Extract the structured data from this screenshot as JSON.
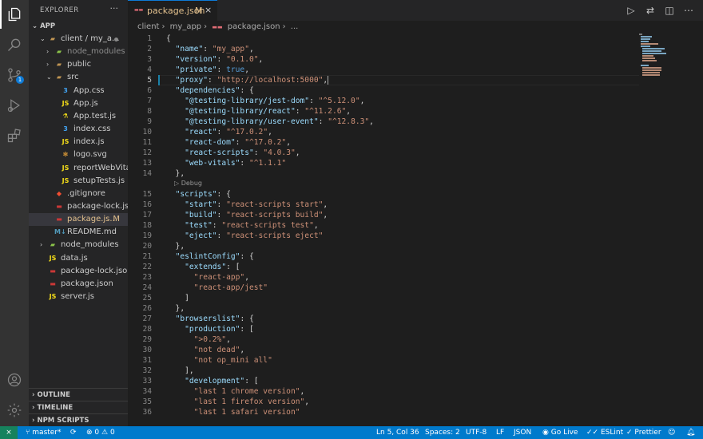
{
  "sidebar": {
    "title": "EXPLORER",
    "more": "···",
    "section": "APP",
    "tree": [
      {
        "name": "client / my_a...",
        "depth": 1,
        "type": "folder",
        "open": true,
        "icon": "folder-icon",
        "dot": true
      },
      {
        "name": "node_modules",
        "depth": 2,
        "type": "folder",
        "open": false,
        "icon": "node-folder-icon",
        "dim": true
      },
      {
        "name": "public",
        "depth": 2,
        "type": "folder",
        "open": false,
        "icon": "folder-icon"
      },
      {
        "name": "src",
        "depth": 2,
        "type": "folder",
        "open": true,
        "icon": "folder-icon"
      },
      {
        "name": "App.css",
        "depth": 3,
        "type": "file",
        "icon": "css-icon"
      },
      {
        "name": "App.js",
        "depth": 3,
        "type": "file",
        "icon": "js-icon"
      },
      {
        "name": "App.test.js",
        "depth": 3,
        "type": "file",
        "icon": "test-icon"
      },
      {
        "name": "index.css",
        "depth": 3,
        "type": "file",
        "icon": "css-icon"
      },
      {
        "name": "index.js",
        "depth": 3,
        "type": "file",
        "icon": "js-icon"
      },
      {
        "name": "logo.svg",
        "depth": 3,
        "type": "file",
        "icon": "svg-icon"
      },
      {
        "name": "reportWebVita...",
        "depth": 3,
        "type": "file",
        "icon": "js-icon"
      },
      {
        "name": "setupTests.js",
        "depth": 3,
        "type": "file",
        "icon": "js-icon"
      },
      {
        "name": ".gitignore",
        "depth": 2,
        "type": "file",
        "icon": "git-icon"
      },
      {
        "name": "package-lock.js...",
        "depth": 2,
        "type": "file",
        "icon": "npm-icon"
      },
      {
        "name": "package.js...",
        "depth": 2,
        "type": "file",
        "icon": "npm-icon",
        "selected": true,
        "mod": "M"
      },
      {
        "name": "README.md",
        "depth": 2,
        "type": "file",
        "icon": "md-icon"
      },
      {
        "name": "node_modules",
        "depth": 1,
        "type": "folder",
        "open": false,
        "icon": "node-folder-icon"
      },
      {
        "name": "data.js",
        "depth": 1,
        "type": "file",
        "icon": "js-icon"
      },
      {
        "name": "package-lock.json",
        "depth": 1,
        "type": "file",
        "icon": "npm-icon"
      },
      {
        "name": "package.json",
        "depth": 1,
        "type": "file",
        "icon": "npm-icon"
      },
      {
        "name": "server.js",
        "depth": 1,
        "type": "file",
        "icon": "js-icon"
      }
    ],
    "bottom_sections": [
      "OUTLINE",
      "TIMELINE",
      "NPM SCRIPTS"
    ]
  },
  "tab": {
    "label": "package.json",
    "mod": "M",
    "close": "×"
  },
  "breadcrumb": [
    "client",
    "my_app",
    "package.json",
    "..."
  ],
  "codelens": "▷ Debug",
  "colors": {
    "accent": "#007acc",
    "remote": "#16825d",
    "modified": "#e2c08d",
    "key": "#9cdcfe",
    "string": "#ce9178",
    "keyword": "#569cd6"
  },
  "code_lines": [
    {
      "n": "1",
      "t": [
        [
          "p",
          "{"
        ]
      ]
    },
    {
      "n": "2",
      "t": [
        [
          "p",
          "  "
        ],
        [
          "k",
          "\"name\""
        ],
        [
          "p",
          ": "
        ],
        [
          "s",
          "\"my_app\""
        ],
        [
          "p",
          ","
        ]
      ]
    },
    {
      "n": "3",
      "t": [
        [
          "p",
          "  "
        ],
        [
          "k",
          "\"version\""
        ],
        [
          "p",
          ": "
        ],
        [
          "s",
          "\"0.1.0\""
        ],
        [
          "p",
          ","
        ]
      ]
    },
    {
      "n": "4",
      "t": [
        [
          "p",
          "  "
        ],
        [
          "k",
          "\"private\""
        ],
        [
          "p",
          ": "
        ],
        [
          "b",
          "true"
        ],
        [
          "p",
          ","
        ]
      ]
    },
    {
      "n": "5",
      "t": [
        [
          "p",
          "  "
        ],
        [
          "k",
          "\"proxy\""
        ],
        [
          "p",
          ": "
        ],
        [
          "s",
          "\"http://localhost:5000\""
        ],
        [
          "p",
          ","
        ]
      ],
      "current": true
    },
    {
      "n": "6",
      "t": [
        [
          "p",
          "  "
        ],
        [
          "k",
          "\"dependencies\""
        ],
        [
          "p",
          ": {"
        ]
      ]
    },
    {
      "n": "7",
      "t": [
        [
          "p",
          "    "
        ],
        [
          "k",
          "\"@testing-library/jest-dom\""
        ],
        [
          "p",
          ": "
        ],
        [
          "s",
          "\"^5.12.0\""
        ],
        [
          "p",
          ","
        ]
      ]
    },
    {
      "n": "8",
      "t": [
        [
          "p",
          "    "
        ],
        [
          "k",
          "\"@testing-library/react\""
        ],
        [
          "p",
          ": "
        ],
        [
          "s",
          "\"^11.2.6\""
        ],
        [
          "p",
          ","
        ]
      ]
    },
    {
      "n": "9",
      "t": [
        [
          "p",
          "    "
        ],
        [
          "k",
          "\"@testing-library/user-event\""
        ],
        [
          "p",
          ": "
        ],
        [
          "s",
          "\"^12.8.3\""
        ],
        [
          "p",
          ","
        ]
      ]
    },
    {
      "n": "10",
      "t": [
        [
          "p",
          "    "
        ],
        [
          "k",
          "\"react\""
        ],
        [
          "p",
          ": "
        ],
        [
          "s",
          "\"^17.0.2\""
        ],
        [
          "p",
          ","
        ]
      ]
    },
    {
      "n": "11",
      "t": [
        [
          "p",
          "    "
        ],
        [
          "k",
          "\"react-dom\""
        ],
        [
          "p",
          ": "
        ],
        [
          "s",
          "\"^17.0.2\""
        ],
        [
          "p",
          ","
        ]
      ]
    },
    {
      "n": "12",
      "t": [
        [
          "p",
          "    "
        ],
        [
          "k",
          "\"react-scripts\""
        ],
        [
          "p",
          ": "
        ],
        [
          "s",
          "\"4.0.3\""
        ],
        [
          "p",
          ","
        ]
      ]
    },
    {
      "n": "13",
      "t": [
        [
          "p",
          "    "
        ],
        [
          "k",
          "\"web-vitals\""
        ],
        [
          "p",
          ": "
        ],
        [
          "s",
          "\"^1.1.1\""
        ]
      ]
    },
    {
      "n": "14",
      "t": [
        [
          "p",
          "  },"
        ]
      ]
    },
    {
      "n": "15",
      "t": [
        [
          "p",
          "  "
        ],
        [
          "k",
          "\"scripts\""
        ],
        [
          "p",
          ": {"
        ]
      ],
      "lens": true
    },
    {
      "n": "16",
      "t": [
        [
          "p",
          "    "
        ],
        [
          "k",
          "\"start\""
        ],
        [
          "p",
          ": "
        ],
        [
          "s",
          "\"react-scripts start\""
        ],
        [
          "p",
          ","
        ]
      ]
    },
    {
      "n": "17",
      "t": [
        [
          "p",
          "    "
        ],
        [
          "k",
          "\"build\""
        ],
        [
          "p",
          ": "
        ],
        [
          "s",
          "\"react-scripts build\""
        ],
        [
          "p",
          ","
        ]
      ]
    },
    {
      "n": "18",
      "t": [
        [
          "p",
          "    "
        ],
        [
          "k",
          "\"test\""
        ],
        [
          "p",
          ": "
        ],
        [
          "s",
          "\"react-scripts test\""
        ],
        [
          "p",
          ","
        ]
      ]
    },
    {
      "n": "19",
      "t": [
        [
          "p",
          "    "
        ],
        [
          "k",
          "\"eject\""
        ],
        [
          "p",
          ": "
        ],
        [
          "s",
          "\"react-scripts eject\""
        ]
      ]
    },
    {
      "n": "20",
      "t": [
        [
          "p",
          "  },"
        ]
      ]
    },
    {
      "n": "21",
      "t": [
        [
          "p",
          "  "
        ],
        [
          "k",
          "\"eslintConfig\""
        ],
        [
          "p",
          ": {"
        ]
      ]
    },
    {
      "n": "22",
      "t": [
        [
          "p",
          "    "
        ],
        [
          "k",
          "\"extends\""
        ],
        [
          "p",
          ": ["
        ]
      ]
    },
    {
      "n": "23",
      "t": [
        [
          "p",
          "      "
        ],
        [
          "s",
          "\"react-app\""
        ],
        [
          "p",
          ","
        ]
      ]
    },
    {
      "n": "24",
      "t": [
        [
          "p",
          "      "
        ],
        [
          "s",
          "\"react-app/jest\""
        ]
      ]
    },
    {
      "n": "25",
      "t": [
        [
          "p",
          "    ]"
        ]
      ]
    },
    {
      "n": "26",
      "t": [
        [
          "p",
          "  },"
        ]
      ]
    },
    {
      "n": "27",
      "t": [
        [
          "p",
          "  "
        ],
        [
          "k",
          "\"browserslist\""
        ],
        [
          "p",
          ": {"
        ]
      ]
    },
    {
      "n": "28",
      "t": [
        [
          "p",
          "    "
        ],
        [
          "k",
          "\"production\""
        ],
        [
          "p",
          ": ["
        ]
      ]
    },
    {
      "n": "29",
      "t": [
        [
          "p",
          "      "
        ],
        [
          "s",
          "\">0.2%\""
        ],
        [
          "p",
          ","
        ]
      ]
    },
    {
      "n": "30",
      "t": [
        [
          "p",
          "      "
        ],
        [
          "s",
          "\"not dead\""
        ],
        [
          "p",
          ","
        ]
      ]
    },
    {
      "n": "31",
      "t": [
        [
          "p",
          "      "
        ],
        [
          "s",
          "\"not op_mini all\""
        ]
      ]
    },
    {
      "n": "32",
      "t": [
        [
          "p",
          "    ],"
        ]
      ]
    },
    {
      "n": "33",
      "t": [
        [
          "p",
          "    "
        ],
        [
          "k",
          "\"development\""
        ],
        [
          "p",
          ": ["
        ]
      ]
    },
    {
      "n": "34",
      "t": [
        [
          "p",
          "      "
        ],
        [
          "s",
          "\"last 1 chrome version\""
        ],
        [
          "p",
          ","
        ]
      ]
    },
    {
      "n": "35",
      "t": [
        [
          "p",
          "      "
        ],
        [
          "s",
          "\"last 1 firefox version\""
        ],
        [
          "p",
          ","
        ]
      ]
    },
    {
      "n": "36",
      "t": [
        [
          "p",
          "      "
        ],
        [
          "s",
          "\"last 1 safari version\""
        ]
      ]
    }
  ],
  "status": {
    "branch": "master*",
    "problems_errors": "0",
    "problems_warnings": "0",
    "position": "Ln 5, Col 36",
    "spaces": "Spaces: 2",
    "encoding": "UTF-8",
    "eol": "LF",
    "language": "JSON",
    "golive": "Go Live",
    "eslint": "ESLint",
    "prettier": "Prettier"
  },
  "badge_count": "1"
}
